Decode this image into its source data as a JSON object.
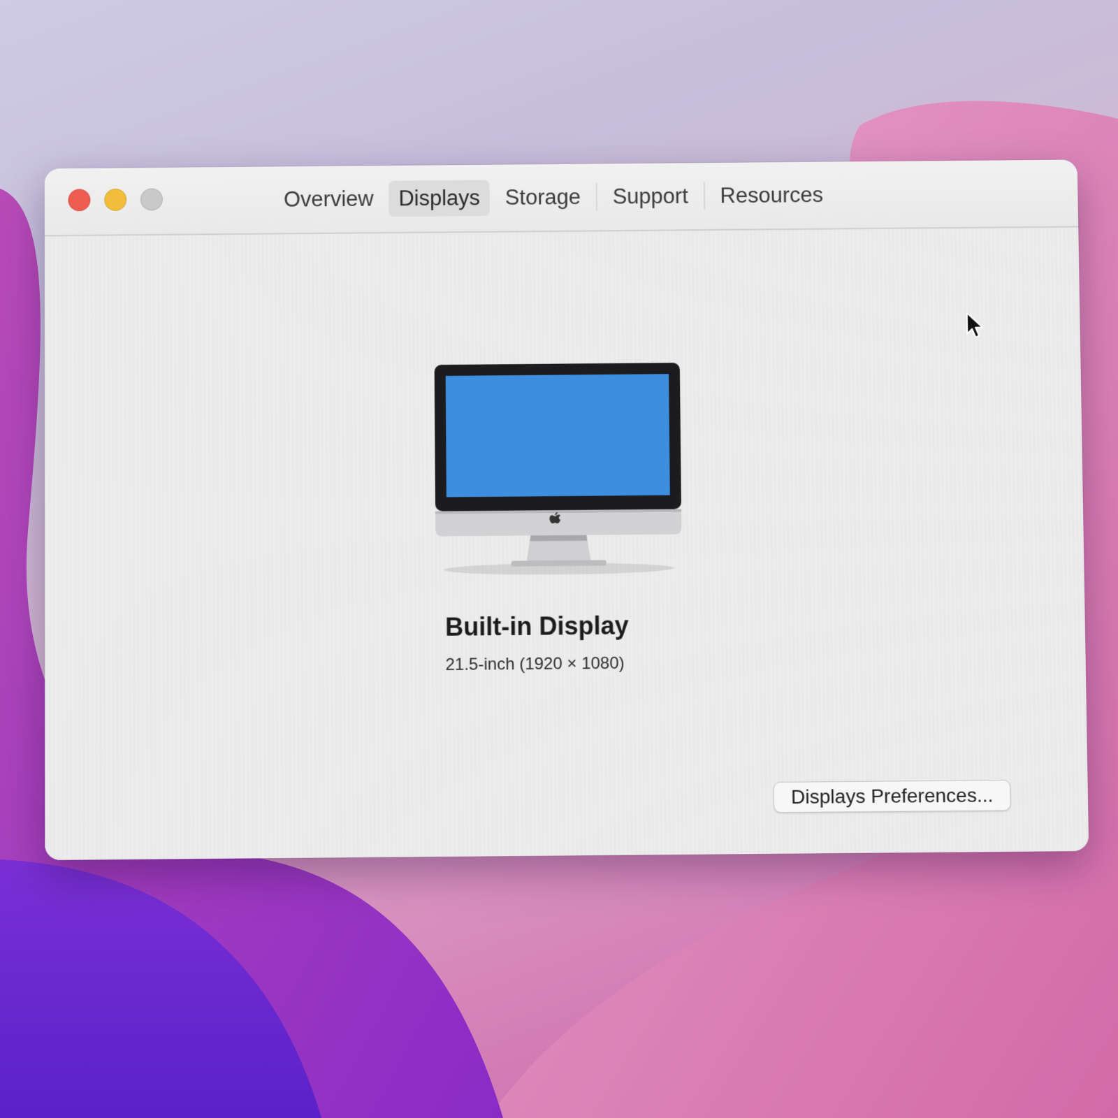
{
  "window": {
    "traffic_lights": {
      "close": {
        "color": "#ee5c52"
      },
      "minimize": {
        "color": "#f1bd3a"
      },
      "zoom": {
        "color": "#c9c9c9"
      }
    },
    "tabs": [
      {
        "label": "Overview",
        "active": false
      },
      {
        "label": "Displays",
        "active": true
      },
      {
        "label": "Storage",
        "active": false
      },
      {
        "label": "Support",
        "active": false
      },
      {
        "label": "Resources",
        "active": false
      }
    ]
  },
  "display": {
    "icon": "imac-icon",
    "screen_color": "#3d8ede",
    "name": "Built-in Display",
    "specs": "21.5-inch (1920 × 1080)"
  },
  "actions": {
    "preferences_button_label": "Displays Preferences..."
  },
  "cursor": {
    "icon": "mouse-pointer-icon"
  }
}
